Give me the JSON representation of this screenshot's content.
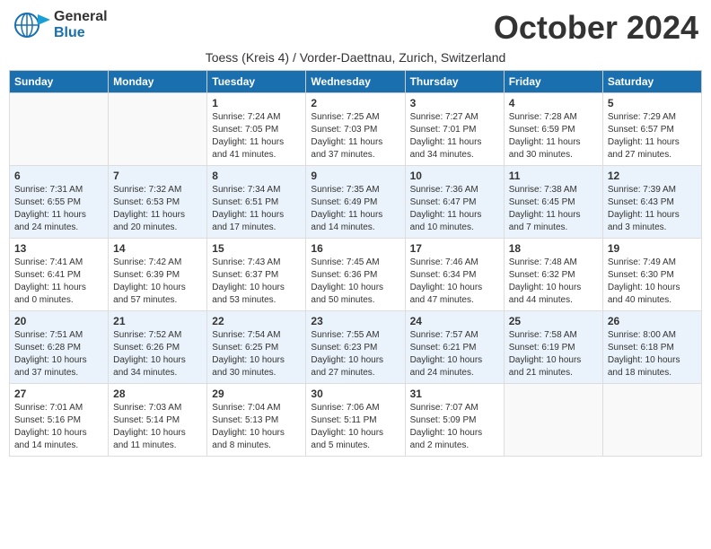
{
  "header": {
    "logo_general": "General",
    "logo_blue": "Blue",
    "month": "October 2024",
    "subtitle": "Toess (Kreis 4) / Vorder-Daettnau, Zurich, Switzerland"
  },
  "weekdays": [
    "Sunday",
    "Monday",
    "Tuesday",
    "Wednesday",
    "Thursday",
    "Friday",
    "Saturday"
  ],
  "weeks": [
    [
      {
        "day": "",
        "info": ""
      },
      {
        "day": "",
        "info": ""
      },
      {
        "day": "1",
        "info": "Sunrise: 7:24 AM\nSunset: 7:05 PM\nDaylight: 11 hours and 41 minutes."
      },
      {
        "day": "2",
        "info": "Sunrise: 7:25 AM\nSunset: 7:03 PM\nDaylight: 11 hours and 37 minutes."
      },
      {
        "day": "3",
        "info": "Sunrise: 7:27 AM\nSunset: 7:01 PM\nDaylight: 11 hours and 34 minutes."
      },
      {
        "day": "4",
        "info": "Sunrise: 7:28 AM\nSunset: 6:59 PM\nDaylight: 11 hours and 30 minutes."
      },
      {
        "day": "5",
        "info": "Sunrise: 7:29 AM\nSunset: 6:57 PM\nDaylight: 11 hours and 27 minutes."
      }
    ],
    [
      {
        "day": "6",
        "info": "Sunrise: 7:31 AM\nSunset: 6:55 PM\nDaylight: 11 hours and 24 minutes."
      },
      {
        "day": "7",
        "info": "Sunrise: 7:32 AM\nSunset: 6:53 PM\nDaylight: 11 hours and 20 minutes."
      },
      {
        "day": "8",
        "info": "Sunrise: 7:34 AM\nSunset: 6:51 PM\nDaylight: 11 hours and 17 minutes."
      },
      {
        "day": "9",
        "info": "Sunrise: 7:35 AM\nSunset: 6:49 PM\nDaylight: 11 hours and 14 minutes."
      },
      {
        "day": "10",
        "info": "Sunrise: 7:36 AM\nSunset: 6:47 PM\nDaylight: 11 hours and 10 minutes."
      },
      {
        "day": "11",
        "info": "Sunrise: 7:38 AM\nSunset: 6:45 PM\nDaylight: 11 hours and 7 minutes."
      },
      {
        "day": "12",
        "info": "Sunrise: 7:39 AM\nSunset: 6:43 PM\nDaylight: 11 hours and 3 minutes."
      }
    ],
    [
      {
        "day": "13",
        "info": "Sunrise: 7:41 AM\nSunset: 6:41 PM\nDaylight: 11 hours and 0 minutes."
      },
      {
        "day": "14",
        "info": "Sunrise: 7:42 AM\nSunset: 6:39 PM\nDaylight: 10 hours and 57 minutes."
      },
      {
        "day": "15",
        "info": "Sunrise: 7:43 AM\nSunset: 6:37 PM\nDaylight: 10 hours and 53 minutes."
      },
      {
        "day": "16",
        "info": "Sunrise: 7:45 AM\nSunset: 6:36 PM\nDaylight: 10 hours and 50 minutes."
      },
      {
        "day": "17",
        "info": "Sunrise: 7:46 AM\nSunset: 6:34 PM\nDaylight: 10 hours and 47 minutes."
      },
      {
        "day": "18",
        "info": "Sunrise: 7:48 AM\nSunset: 6:32 PM\nDaylight: 10 hours and 44 minutes."
      },
      {
        "day": "19",
        "info": "Sunrise: 7:49 AM\nSunset: 6:30 PM\nDaylight: 10 hours and 40 minutes."
      }
    ],
    [
      {
        "day": "20",
        "info": "Sunrise: 7:51 AM\nSunset: 6:28 PM\nDaylight: 10 hours and 37 minutes."
      },
      {
        "day": "21",
        "info": "Sunrise: 7:52 AM\nSunset: 6:26 PM\nDaylight: 10 hours and 34 minutes."
      },
      {
        "day": "22",
        "info": "Sunrise: 7:54 AM\nSunset: 6:25 PM\nDaylight: 10 hours and 30 minutes."
      },
      {
        "day": "23",
        "info": "Sunrise: 7:55 AM\nSunset: 6:23 PM\nDaylight: 10 hours and 27 minutes."
      },
      {
        "day": "24",
        "info": "Sunrise: 7:57 AM\nSunset: 6:21 PM\nDaylight: 10 hours and 24 minutes."
      },
      {
        "day": "25",
        "info": "Sunrise: 7:58 AM\nSunset: 6:19 PM\nDaylight: 10 hours and 21 minutes."
      },
      {
        "day": "26",
        "info": "Sunrise: 8:00 AM\nSunset: 6:18 PM\nDaylight: 10 hours and 18 minutes."
      }
    ],
    [
      {
        "day": "27",
        "info": "Sunrise: 7:01 AM\nSunset: 5:16 PM\nDaylight: 10 hours and 14 minutes."
      },
      {
        "day": "28",
        "info": "Sunrise: 7:03 AM\nSunset: 5:14 PM\nDaylight: 10 hours and 11 minutes."
      },
      {
        "day": "29",
        "info": "Sunrise: 7:04 AM\nSunset: 5:13 PM\nDaylight: 10 hours and 8 minutes."
      },
      {
        "day": "30",
        "info": "Sunrise: 7:06 AM\nSunset: 5:11 PM\nDaylight: 10 hours and 5 minutes."
      },
      {
        "day": "31",
        "info": "Sunrise: 7:07 AM\nSunset: 5:09 PM\nDaylight: 10 hours and 2 minutes."
      },
      {
        "day": "",
        "info": ""
      },
      {
        "day": "",
        "info": ""
      }
    ]
  ]
}
